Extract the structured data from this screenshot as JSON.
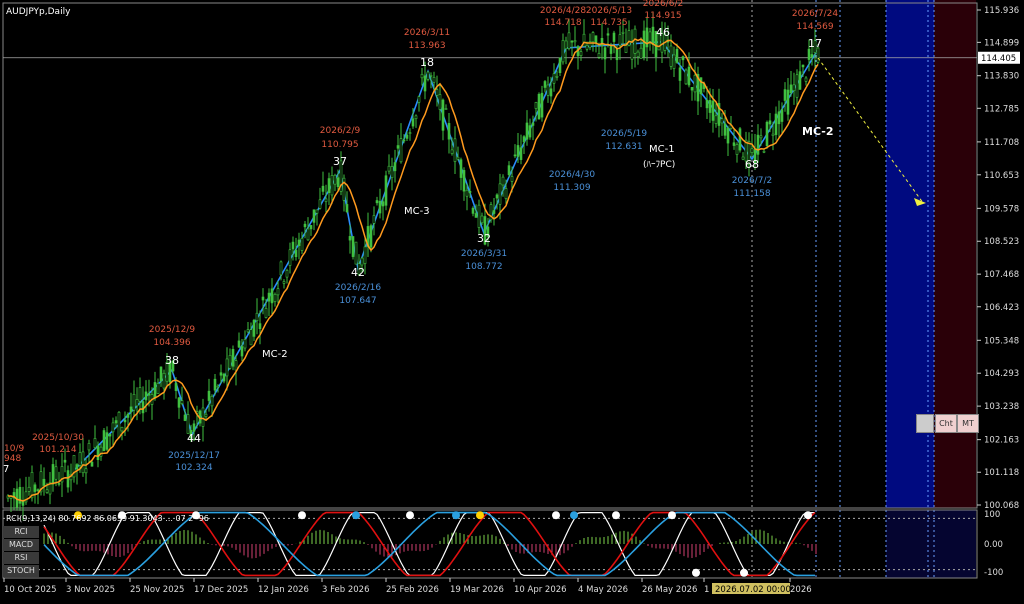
{
  "symbol_title": "AUDJPYp,Daily",
  "price_axis": [
    "115.936",
    "114.899",
    "113.830",
    "112.785",
    "111.708",
    "110.653",
    "109.578",
    "108.523",
    "107.468",
    "106.423",
    "105.348",
    "104.293",
    "103.238",
    "102.163",
    "101.118",
    "100.068"
  ],
  "current_price": "114.405",
  "date_axis": [
    "10 Oct 2025",
    "3 Nov 2025",
    "25 Nov 2025",
    "17 Dec 2025",
    "12 Jan 2026",
    "3 Feb 2026",
    "25 Feb 2026",
    "19 Mar 2026",
    "10 Apr 2026",
    "4 May 2026",
    "26 May 2026",
    "1",
    "2026"
  ],
  "date_cursor_label": "2026.07.02 00:00",
  "wave_points": [
    {
      "count": "",
      "date": "10/9",
      "price": "948"
    },
    {
      "count": "",
      "date": "2025/10/30",
      "price": "101.214"
    },
    {
      "count": "38",
      "date": "2025/12/9",
      "price": "104.396"
    },
    {
      "count": "44",
      "date": "2025/12/17",
      "price": "102.324"
    },
    {
      "count": "37",
      "date": "2026/2/9",
      "price": "110.795"
    },
    {
      "count": "42",
      "date": "2026/2/16",
      "price": "107.647"
    },
    {
      "count": "18",
      "date": "2026/3/11",
      "price": "113.963"
    },
    {
      "count": "32",
      "date": "2026/3/31",
      "price": "108.772"
    },
    {
      "count": "",
      "date": "2026/4/30",
      "price": "111.309"
    },
    {
      "count": "",
      "date": "2026/4/28",
      "price": "114.718"
    },
    {
      "count": "",
      "date": "2026/5/13",
      "price": "114.735"
    },
    {
      "count": "",
      "date": "2026/5/19",
      "price": "112.631"
    },
    {
      "count": "46",
      "date": "2026/6/2",
      "price": "114.915"
    },
    {
      "count": "68",
      "date": "2026/7/2",
      "price": "111.158"
    },
    {
      "count": "17",
      "date": "2026/7/24",
      "price": "114.569"
    }
  ],
  "labels": {
    "mc1": "MC-1",
    "mc1_sub": "(ﾊｰﾌPC)",
    "mc2a": "MC-2",
    "mc3": "MC-3",
    "mc2b": "MC-2",
    "seven": "7"
  },
  "subwindow": {
    "header": "RCI(9,13,24) 80.7692 86.0659 91.3043 ... 07 2 -96",
    "buttons": [
      "RCI",
      "MACD",
      "RSI",
      "STOCH"
    ],
    "axis": [
      "100",
      "0.00",
      "-100"
    ],
    "markers": [
      "2",
      "3",
      "2",
      "3",
      "2"
    ]
  },
  "mini_buttons": [
    "",
    "Cht",
    "MT"
  ],
  "colors": {
    "zigzag": "#2a8cff",
    "ma": "#ff9a1e",
    "candle": "#40c040",
    "high_label": "#e05a40",
    "low_label": "#4a90d8",
    "band_blue": "#000a80",
    "band_red": "#2a0008",
    "grid": "#ffffff"
  }
}
